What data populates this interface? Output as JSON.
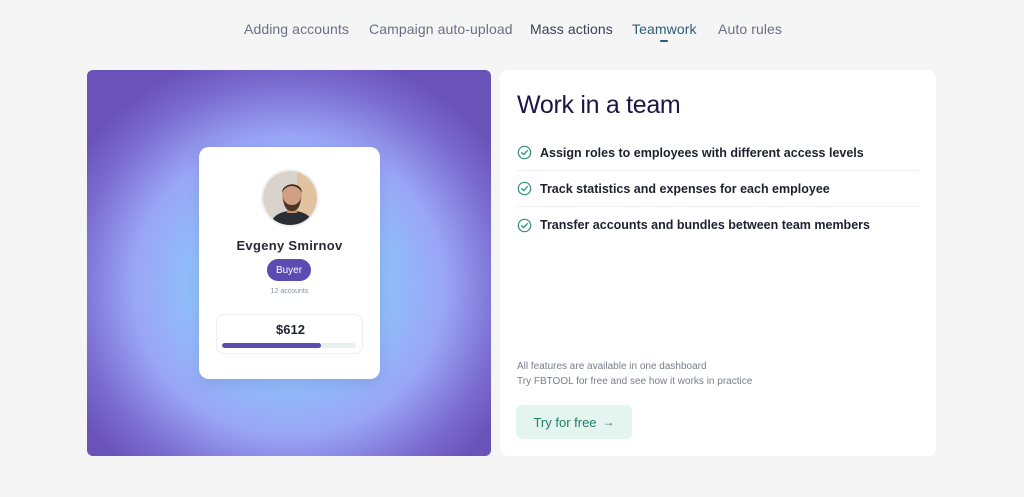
{
  "tabs": [
    {
      "label": "Adding accounts"
    },
    {
      "label": "Campaign auto-upload"
    },
    {
      "label": "Mass actions"
    },
    {
      "label": "Teamwork"
    },
    {
      "label": "Auto rules"
    }
  ],
  "profile": {
    "name": "Evgeny Smirnov",
    "role": "Buyer",
    "accounts": "12 accounts",
    "amount": "$612",
    "progress_fraction": 0.74
  },
  "panel": {
    "title": "Work in a team",
    "features": [
      "Assign roles to employees with different access levels",
      "Track statistics and expenses for each employee",
      "Transfer accounts and bundles between team members"
    ],
    "footnote_line1": "All features are available in one dashboard",
    "footnote_line2": "Try FBTOOL for free and see how it works in practice",
    "cta_label": "Try for free",
    "cta_arrow": "→"
  },
  "colors": {
    "accent_purple": "#5d4bb4",
    "accent_green": "#1f7d66",
    "active_tab": "#2b5b78"
  }
}
